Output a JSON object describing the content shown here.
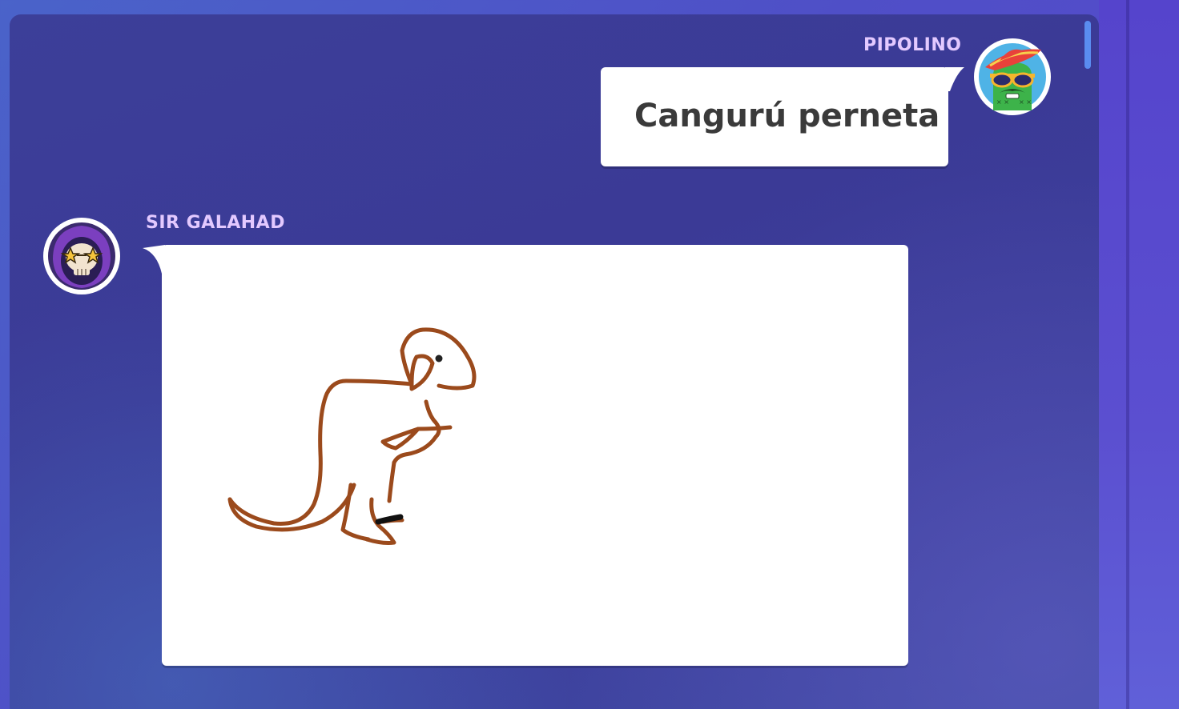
{
  "messages": [
    {
      "sender": "PIPOLINO",
      "avatar_icon": "cactus-mariachi-avatar-icon",
      "text": "Cangurú perneta"
    },
    {
      "sender": "SIR GALAHAD",
      "avatar_icon": "skull-star-glasses-avatar-icon",
      "drawing_icon": "kangaroo-drawing-icon"
    }
  ],
  "colors": {
    "name": "#e3c9ff",
    "panel": "#3c3f99",
    "bubble": "#ffffff",
    "drawing_stroke": "#9b4a1c",
    "scrollbar": "#5a8cf0"
  }
}
